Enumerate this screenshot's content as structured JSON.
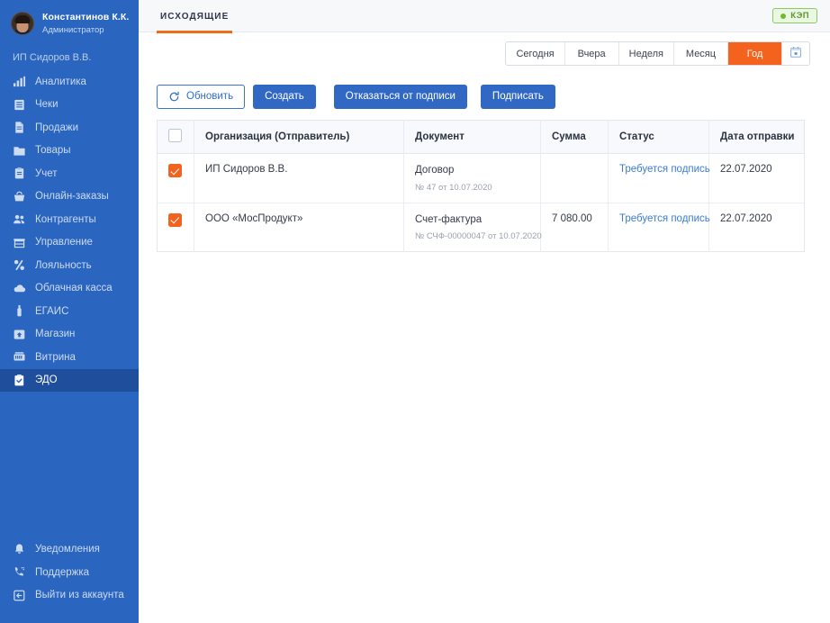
{
  "sidebar": {
    "profile": {
      "name": "Константинов К.К.",
      "role": "Администратор",
      "avatar_icon": "user-avatar"
    },
    "org_label": "ИП Сидоров В.В.",
    "items": [
      {
        "label": "Аналитика",
        "icon": "bar-chart-icon",
        "active": false
      },
      {
        "label": "Чеки",
        "icon": "receipt-icon",
        "active": false
      },
      {
        "label": "Продажи",
        "icon": "document-icon",
        "active": false
      },
      {
        "label": "Товары",
        "icon": "folder-icon",
        "active": false
      },
      {
        "label": "Учет",
        "icon": "clipboard-icon",
        "active": false
      },
      {
        "label": "Онлайн-заказы",
        "icon": "basket-icon",
        "active": false
      },
      {
        "label": "Контрагенты",
        "icon": "users-icon",
        "active": false
      },
      {
        "label": "Управление",
        "icon": "store-icon",
        "active": false
      },
      {
        "label": "Лояльность",
        "icon": "percent-icon",
        "active": false
      },
      {
        "label": "Облачная касса",
        "icon": "cloud-icon",
        "active": false
      },
      {
        "label": "ЕГАИС",
        "icon": "bottle-icon",
        "active": false
      },
      {
        "label": "Магазин",
        "icon": "shop-square-icon",
        "active": false
      },
      {
        "label": "Витрина",
        "icon": "showcase-icon",
        "active": false
      },
      {
        "label": "ЭДО",
        "icon": "edo-clipboard-icon",
        "active": true
      }
    ],
    "bottom_items": [
      {
        "label": "Уведомления",
        "icon": "bell-icon"
      },
      {
        "label": "Поддержка",
        "icon": "phone-support-icon"
      },
      {
        "label": "Выйти из аккаунта",
        "icon": "logout-icon"
      }
    ]
  },
  "topbar": {
    "tabs": [
      {
        "label": "Исходящие",
        "active": true
      }
    ],
    "kep_badge": {
      "label": "КЭП",
      "dot_color": "#6fbb2e"
    }
  },
  "filters": {
    "periods": [
      {
        "label": "Сегодня",
        "active": false
      },
      {
        "label": "Вчера",
        "active": false
      },
      {
        "label": "Неделя",
        "active": false
      },
      {
        "label": "Месяц",
        "active": false
      },
      {
        "label": "Год",
        "active": true
      }
    ],
    "calendar_icon": "calendar-icon"
  },
  "actions": {
    "refresh": {
      "label": "Обновить",
      "icon": "refresh-icon"
    },
    "create": {
      "label": "Создать"
    },
    "reject": {
      "label": "Отказаться от подписи"
    },
    "sign": {
      "label": "Подписать"
    }
  },
  "table": {
    "select_all_checked": false,
    "columns": [
      "Организация (Отправитель)",
      "Документ",
      "Сумма",
      "Статус",
      "Дата отправки"
    ],
    "rows": [
      {
        "checked": true,
        "organization": "ИП Сидоров В.В.",
        "doc_title": "Договор",
        "doc_sub": "№ 47 от 10.07.2020",
        "sum": "",
        "status": "Требуется подпись",
        "date": "22.07.2020"
      },
      {
        "checked": true,
        "organization": "ООО «МосПродукт»",
        "doc_title": "Счет-фактура",
        "doc_sub": "№ СЧФ-00000047 от 10.07.2020",
        "sum": "7 080.00",
        "status": "Требуется подпись",
        "date": "22.07.2020"
      }
    ]
  },
  "colors": {
    "sidebar_bg": "#2a65c0",
    "sidebar_active": "#1f4f9c",
    "accent_orange": "#f4631e",
    "tab_underline": "#ef6c18",
    "primary_blue": "#3068c4",
    "link_blue": "#3a7bd5",
    "badge_green": "#6fbb2e"
  }
}
